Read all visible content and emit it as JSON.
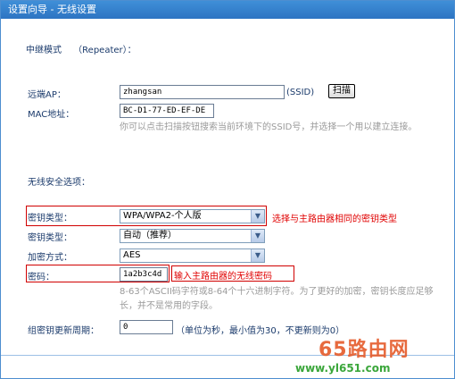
{
  "window": {
    "title": "设置向导 - 无线设置"
  },
  "repeater": {
    "heading": "中继模式　 （Repeater）："
  },
  "ap": {
    "remote_label": "远端AP：",
    "ssid_value": "zhangsan",
    "ssid_suffix": "(SSID)",
    "scan_button": "扫描",
    "mac_label": "MAC地址：",
    "mac_value": "BC-D1-77-ED-EF-DE",
    "hint": "你可以点击扫描按钮搜索当前环境下的SSID号，并选择一个用以建立连接。"
  },
  "security": {
    "heading": "无线安全选项：",
    "key_type_label": "密钥类型：",
    "key_type_value": "WPA/WPA2-个人版",
    "key_type_note": "选择与主路由器相同的密钥类型",
    "key_type2_label": "密钥类型：",
    "key_type2_value": "自动（推荐）",
    "encryption_label": "加密方式：",
    "encryption_value": "AES",
    "password_label": "密码：",
    "password_value": "1a2b3c4d",
    "password_note": "输入主路由器的无线密码",
    "password_hint": "8-63个ASCII码字符或8-64个十六进制字符。为了更好的加密，密钥长度应足够长，并不是常用的字段。",
    "renew_label": "组密钥更新周期：",
    "renew_value": "0",
    "renew_hint": "（单位为秒，最小值为30，不更新则为0）"
  },
  "watermark": {
    "brand": "65路由网",
    "url": "www.yl651.com"
  },
  "colors": {
    "title_bar": "#2d74c2",
    "note_red": "#e00000",
    "label_blue": "#1a3a6b"
  }
}
